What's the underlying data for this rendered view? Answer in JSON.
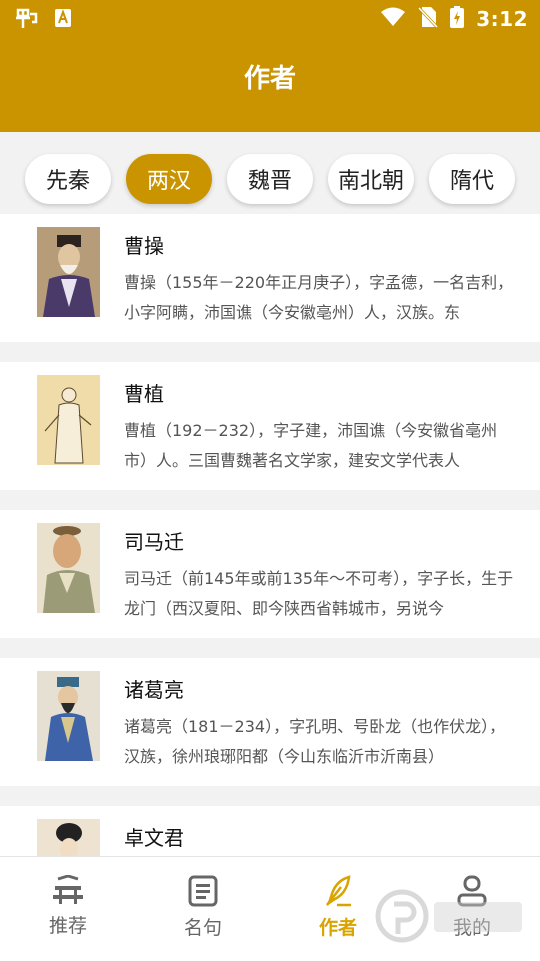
{
  "status": {
    "time": "3:12"
  },
  "header": {
    "title": "作者"
  },
  "categories": [
    "先秦",
    "两汉",
    "魏晋",
    "南北朝",
    "隋代"
  ],
  "authors": [
    {
      "name": "曹操",
      "desc": "曹操（155年－220年正月庚子），字孟德，一名吉利，小字阿瞒，沛国谯（今安徽亳州）人，汉族。东"
    },
    {
      "name": "曹植",
      "desc": "曹植（192－232），字子建，沛国谯（今安徽省亳州市）人。三国曹魏著名文学家，建安文学代表人"
    },
    {
      "name": "司马迁",
      "desc": "司马迁（前145年或前135年～不可考），字子长，生于龙门（西汉夏阳、即今陕西省韩城市，另说今"
    },
    {
      "name": "诸葛亮",
      "desc": "诸葛亮（181－234），字孔明、号卧龙（也作伏龙），汉族，徐州琅琊阳都（今山东临沂市沂南县）"
    },
    {
      "name": "卓文君",
      "desc": ""
    }
  ],
  "nav": [
    {
      "label": "推荐",
      "icon": "pavilion-icon"
    },
    {
      "label": "名句",
      "icon": "document-icon"
    },
    {
      "label": "作者",
      "icon": "quill-icon"
    },
    {
      "label": "我的",
      "icon": "person-icon"
    }
  ],
  "colors": {
    "accent": "#c99400",
    "active_nav": "#d9a300"
  }
}
